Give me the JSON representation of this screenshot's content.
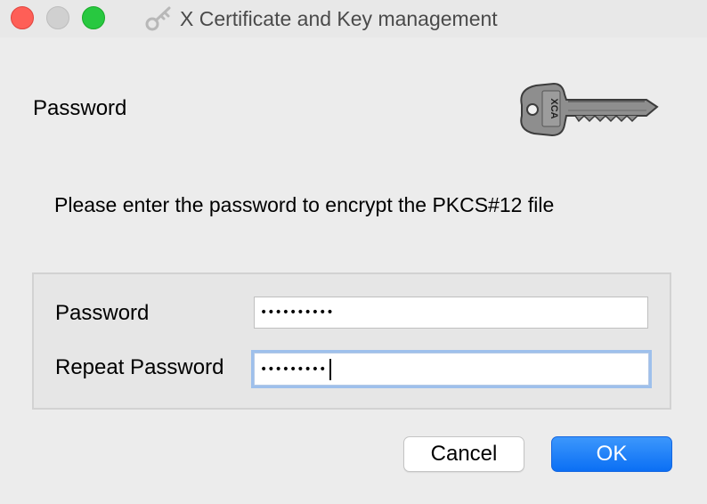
{
  "window": {
    "title": "X Certificate and Key management",
    "title_icon": "key-icon"
  },
  "header": {
    "label": "Password",
    "logo": "xca-key-logo"
  },
  "description": "Please enter the password to encrypt the PKCS#12 file",
  "form": {
    "password": {
      "label": "Password",
      "value": "••••••••••"
    },
    "repeat_password": {
      "label": "Repeat Password",
      "value": "•••••••••",
      "focused": true
    }
  },
  "buttons": {
    "cancel": "Cancel",
    "ok": "OK"
  },
  "colors": {
    "close": "#fe5f57",
    "zoom": "#28c840",
    "ok_button": "#0b6ff4",
    "focus_ring": "#9ec0ec"
  }
}
